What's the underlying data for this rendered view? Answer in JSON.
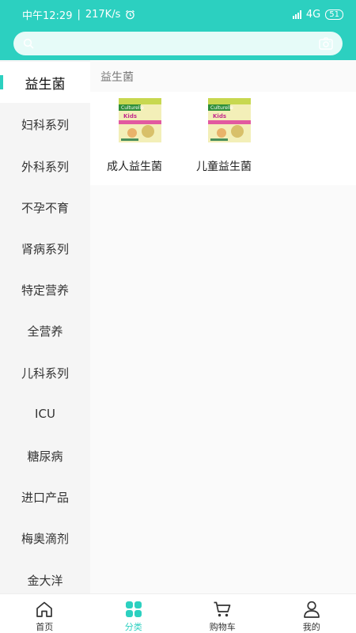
{
  "status_bar": {
    "time": "中午12:29",
    "speed": "217K/s",
    "network": "4G",
    "battery": "51"
  },
  "search": {
    "placeholder": ""
  },
  "sidebar": {
    "items": [
      {
        "label": "益生菌",
        "active": true
      },
      {
        "label": "妇科系列"
      },
      {
        "label": "外科系列"
      },
      {
        "label": "不孕不育"
      },
      {
        "label": "肾病系列"
      },
      {
        "label": "特定营养"
      },
      {
        "label": "全营养"
      },
      {
        "label": "儿科系列"
      },
      {
        "label": "ICU"
      },
      {
        "label": "糖尿病"
      },
      {
        "label": "进口产品"
      },
      {
        "label": "梅奥滴剂"
      },
      {
        "label": "金大洋"
      }
    ]
  },
  "content": {
    "section_title": "益生菌",
    "products": [
      {
        "name": "成人益生菌",
        "image_label": "Culturelle",
        "image_sub": "Kids"
      },
      {
        "name": "儿童益生菌",
        "image_label": "Culturelle",
        "image_sub": "Kids"
      }
    ]
  },
  "tabbar": {
    "tabs": [
      {
        "label": "首页",
        "icon": "home-icon"
      },
      {
        "label": "分类",
        "icon": "category-icon",
        "active": true
      },
      {
        "label": "购物车",
        "icon": "cart-icon"
      },
      {
        "label": "我的",
        "icon": "user-icon"
      }
    ]
  },
  "colors": {
    "accent": "#2cd0c0",
    "sidebar_bg": "#f5f5f5"
  }
}
